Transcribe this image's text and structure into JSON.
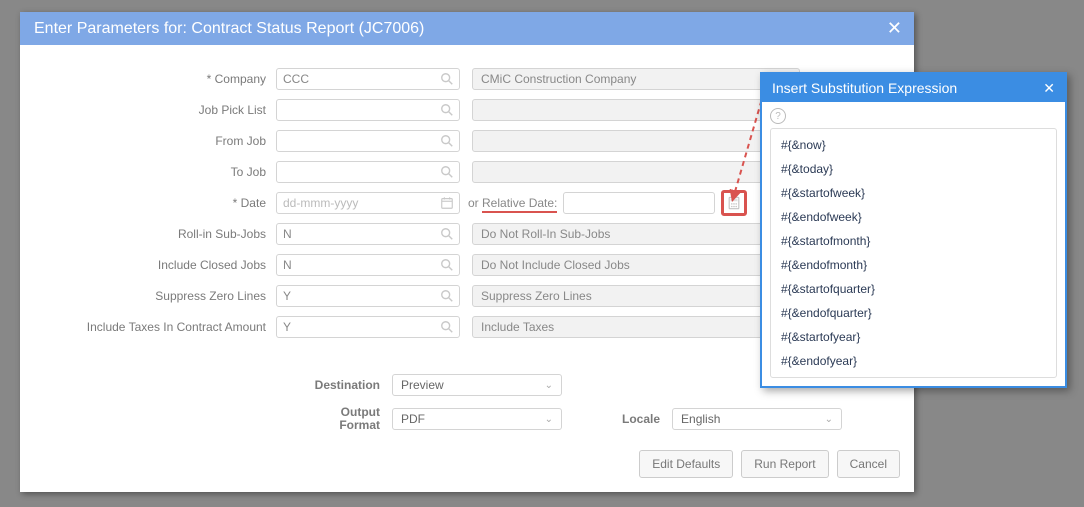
{
  "panel": {
    "title": "Enter Parameters for: Contract Status Report (JC7006)"
  },
  "labels": {
    "company": "Company",
    "jobPickList": "Job Pick List",
    "fromJob": "From Job",
    "toJob": "To Job",
    "date": "Date",
    "rollIn": "Roll-in Sub-Jobs",
    "includeClosed": "Include Closed Jobs",
    "suppressZero": "Suppress Zero Lines",
    "includeTaxes": "Include Taxes In Contract Amount",
    "destination": "Destination",
    "outputFormat": "Output Format",
    "locale": "Locale",
    "orRelative": "or ",
    "relativeDate": "Relative Date:"
  },
  "values": {
    "company": "CCC",
    "companyDesc": "CMiC Construction Company",
    "jobPickList": "",
    "jobPickListDesc": "",
    "fromJob": "",
    "fromJobDesc": "",
    "toJob": "",
    "toJobDesc": "",
    "datePlaceholder": "dd-mmm-yyyy",
    "rollIn": "N",
    "rollInDesc": "Do Not Roll-In Sub-Jobs",
    "includeClosed": "N",
    "includeClosedDesc": "Do Not Include Closed Jobs",
    "suppressZero": "Y",
    "suppressZeroDesc": "Suppress Zero Lines",
    "includeTaxes": "Y",
    "includeTaxesDesc": "Include Taxes",
    "destination": "Preview",
    "outputFormat": "PDF",
    "locale": "English"
  },
  "buttons": {
    "editDefaults": "Edit Defaults",
    "runReport": "Run Report",
    "cancel": "Cancel"
  },
  "popup": {
    "title": "Insert Substitution Expression",
    "items": [
      "#{&now}",
      "#{&today}",
      "#{&startofweek}",
      "#{&endofweek}",
      "#{&startofmonth}",
      "#{&endofmonth}",
      "#{&startofquarter}",
      "#{&endofquarter}",
      "#{&startofyear}",
      "#{&endofyear}"
    ]
  }
}
